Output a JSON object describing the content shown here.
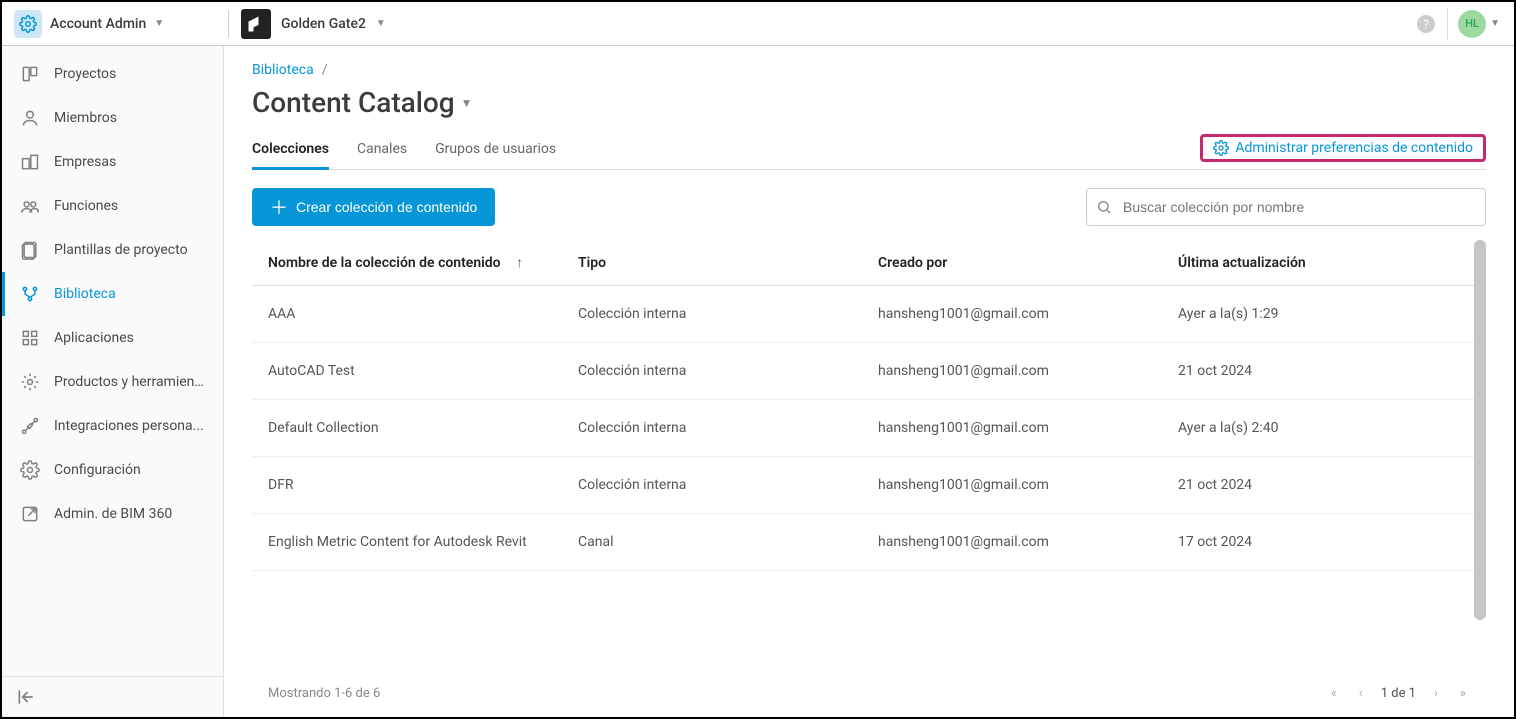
{
  "header": {
    "role_label": "Account Admin",
    "project_name": "Golden Gate2",
    "avatar_initials": "HL"
  },
  "sidebar": {
    "items": [
      {
        "label": "Proyectos",
        "icon": "projects"
      },
      {
        "label": "Miembros",
        "icon": "members"
      },
      {
        "label": "Empresas",
        "icon": "companies"
      },
      {
        "label": "Funciones",
        "icon": "roles"
      },
      {
        "label": "Plantillas de proyecto",
        "icon": "templates"
      },
      {
        "label": "Biblioteca",
        "icon": "library",
        "active": true
      },
      {
        "label": "Aplicaciones",
        "icon": "apps"
      },
      {
        "label": "Productos y herramien...",
        "icon": "products"
      },
      {
        "label": "Integraciones persona...",
        "icon": "integrations"
      },
      {
        "label": "Configuración",
        "icon": "settings"
      },
      {
        "label": "Admin. de BIM 360",
        "icon": "external"
      }
    ]
  },
  "crumbs": {
    "root": "Biblioteca"
  },
  "page": {
    "title": "Content Catalog",
    "tabs": [
      {
        "label": "Colecciones",
        "active": true
      },
      {
        "label": "Canales"
      },
      {
        "label": "Grupos de usuarios"
      }
    ],
    "prefs_link": "Administrar preferencias de contenido"
  },
  "toolbar": {
    "create_label": "Crear colección de contenido",
    "search_placeholder": "Buscar colección por nombre"
  },
  "table": {
    "columns": {
      "name": "Nombre de la colección de contenido",
      "type": "Tipo",
      "created_by": "Creado por",
      "updated": "Última actualización"
    },
    "rows": [
      {
        "name": "AAA",
        "type": "Colección interna",
        "created_by": "hansheng1001@gmail.com",
        "updated": "Ayer a la(s) 1:29"
      },
      {
        "name": "AutoCAD Test",
        "type": "Colección interna",
        "created_by": "hansheng1001@gmail.com",
        "updated": "21 oct 2024"
      },
      {
        "name": "Default Collection",
        "type": "Colección interna",
        "created_by": "hansheng1001@gmail.com",
        "updated": "Ayer a la(s) 2:40"
      },
      {
        "name": "DFR",
        "type": "Colección interna",
        "created_by": "hansheng1001@gmail.com",
        "updated": "21 oct 2024"
      },
      {
        "name": "English Metric Content for Autodesk Revit",
        "type": "Canal",
        "created_by": "hansheng1001@gmail.com",
        "updated": "17 oct 2024"
      }
    ]
  },
  "footer": {
    "summary": "Mostrando 1-6 de 6",
    "page_text": "1 de 1"
  }
}
